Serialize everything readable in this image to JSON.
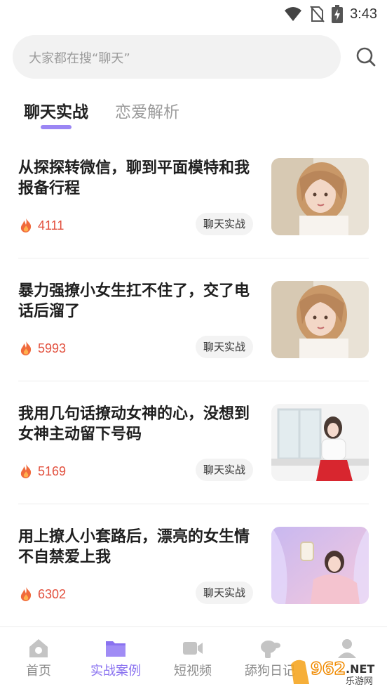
{
  "status_bar": {
    "time": "3:43",
    "icons": [
      "wifi-icon",
      "no-sim-icon",
      "battery-charging-icon"
    ]
  },
  "search": {
    "placeholder": "大家都在搜“聊天”",
    "icon": "search-icon"
  },
  "tabs": [
    {
      "label": "聊天实战",
      "active": true
    },
    {
      "label": "恋爱解析",
      "active": false
    }
  ],
  "articles": [
    {
      "title": "从探探转微信，聊到平面模特和我报备行程",
      "count": "4111",
      "tag": "聊天实战",
      "thumb": "girl-portrait-1"
    },
    {
      "title": "暴力强撩小女生扛不住了，交了电话后溜了",
      "count": "5993",
      "tag": "聊天实战",
      "thumb": "girl-portrait-1"
    },
    {
      "title": "我用几句话撩动女神的心，没想到女神主动留下号码",
      "count": "5169",
      "tag": "聊天实战",
      "thumb": "girl-window"
    },
    {
      "title": "用上撩人小套路后，漂亮的女生情不自禁爱上我",
      "count": "6302",
      "tag": "聊天实战",
      "thumb": "girl-lantern"
    }
  ],
  "bottom_nav": [
    {
      "label": "首页",
      "icon": "home-icon",
      "active": false
    },
    {
      "label": "实战案例",
      "icon": "folder-icon",
      "active": true
    },
    {
      "label": "短视频",
      "icon": "video-icon",
      "active": false
    },
    {
      "label": "舔狗日记",
      "icon": "dog-icon",
      "active": false
    },
    {
      "label": "",
      "icon": "user-icon",
      "active": false
    }
  ],
  "watermark": {
    "top": "962",
    "net": ".NET",
    "sub": "乐游网"
  },
  "colors": {
    "accent": "#9b86f4",
    "count": "#e2503e",
    "flame": "#f06a3c"
  }
}
